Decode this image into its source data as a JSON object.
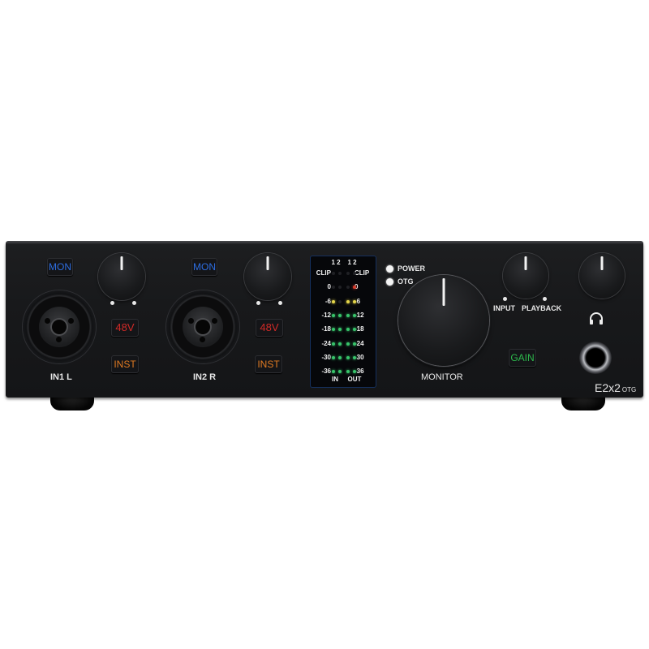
{
  "device": {
    "model_main": "E2x2",
    "model_sub": "OTG",
    "colors": {
      "panel": "#18191b",
      "mon": "#2d6de0",
      "phantom": "#d02a27",
      "inst": "#e07a22",
      "gain": "#2db84c",
      "meter_green": "#37c46a",
      "meter_yellow": "#e4d64a",
      "meter_red": "#d83b2c"
    }
  },
  "channels": [
    {
      "label": "IN1 L",
      "mon": "MON",
      "phantom": "48V",
      "inst": "INST"
    },
    {
      "label": "IN2 R",
      "mon": "MON",
      "phantom": "48V",
      "inst": "INST"
    }
  ],
  "meter": {
    "header_in": "1 2",
    "header_out": "1 2",
    "levels": [
      "CLIP",
      "0",
      "-6",
      "-12",
      "-18",
      "-24",
      "-30",
      "-36"
    ],
    "footer_in": "IN",
    "footer_out": "OUT",
    "lit_leds": {
      "in_1": "-6",
      "in_2": "-12",
      "out_1": "-6",
      "out_2": "0"
    }
  },
  "indicators": {
    "power": "POWER",
    "otg": "OTG"
  },
  "monitor": {
    "label": "MONITOR"
  },
  "mix": {
    "input": "INPUT",
    "playback": "PLAYBACK"
  },
  "gain_button": "GAIN",
  "headphone": {
    "icon": "headphones-icon"
  }
}
